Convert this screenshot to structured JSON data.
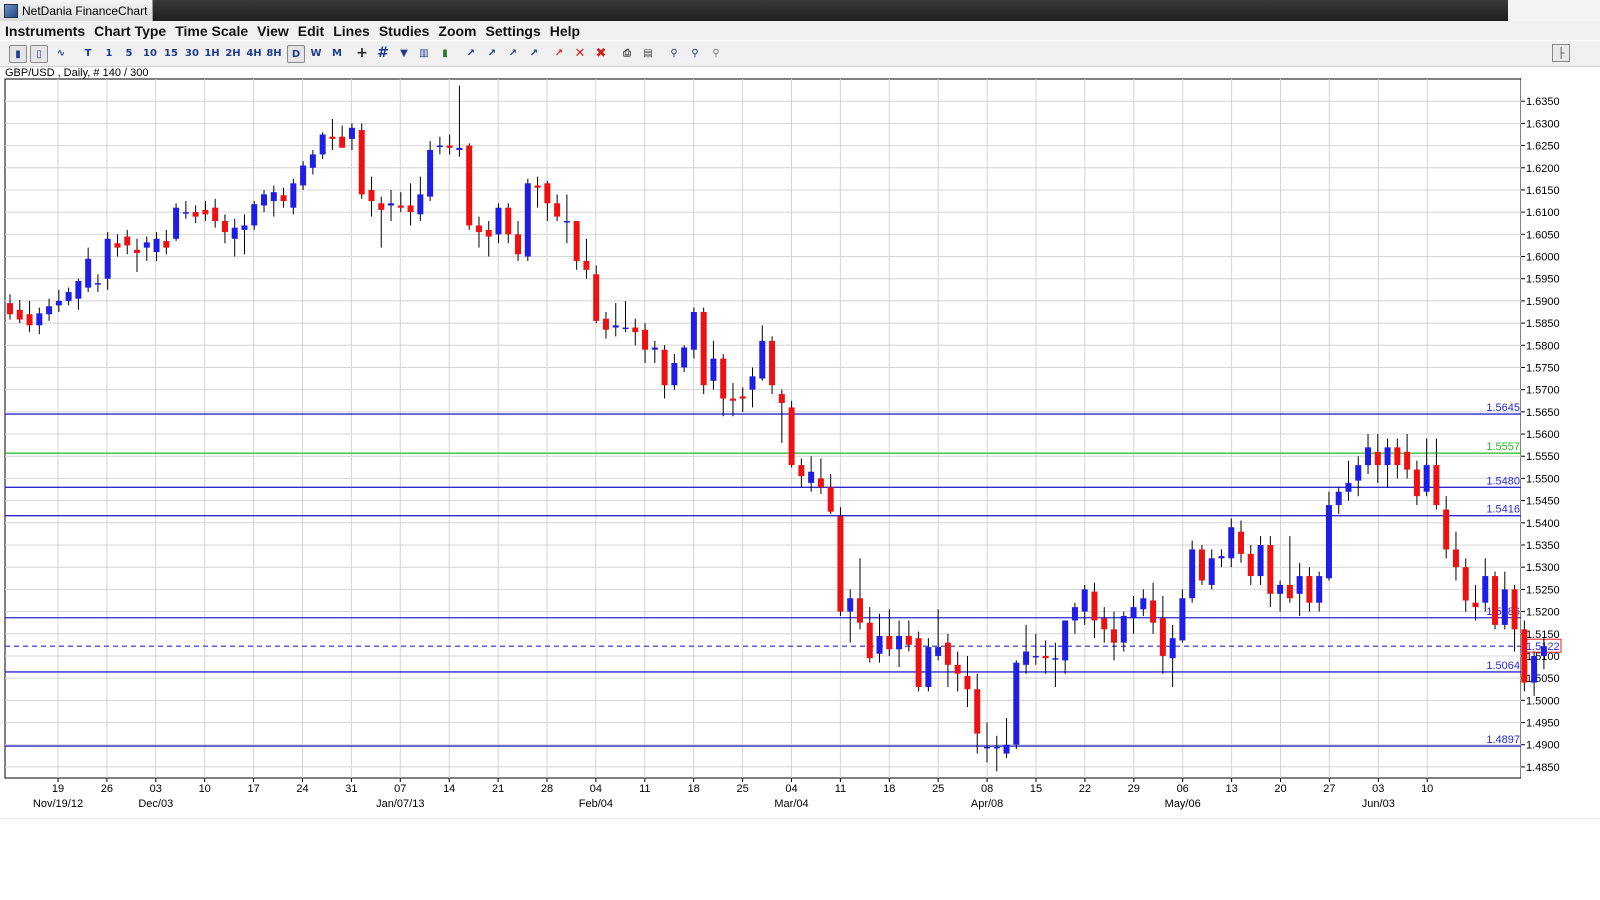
{
  "window": {
    "title": "NetDania FinanceChart"
  },
  "menu": [
    "Instruments",
    "Chart Type",
    "Time Scale",
    "View",
    "Edit",
    "Lines",
    "Studies",
    "Zoom",
    "Settings",
    "Help"
  ],
  "toolbar": {
    "timeframes": [
      "T",
      "1",
      "5",
      "10",
      "15",
      "30",
      "1H",
      "2H",
      "4H",
      "8H",
      "D",
      "W",
      "M"
    ],
    "selected_timeframe": "D",
    "icons": [
      "bar-chart-icon",
      "candlestick-icon",
      "line-chart-icon",
      "crosshair-icon",
      "grid-icon",
      "magnet-icon",
      "volume-icon",
      "fibonacci-icon",
      "studies-icon",
      "delete-line-icon",
      "delete-all-icon",
      "print-icon",
      "print-preview-icon",
      "zoom-in-icon",
      "zoom-out-icon",
      "zoom-reset-icon",
      "pin-icon"
    ]
  },
  "chart_header": "GBP/USD , Daily, # 140 / 300",
  "colors": {
    "up": "#1e1ee6",
    "down": "#ee1111",
    "level": "#2a2ad0",
    "level_green": "#22bb22",
    "grid": "#d4d4d4"
  },
  "chart_data": {
    "type": "candlestick",
    "symbol": "GBP/USD",
    "ylim": [
      1.4825,
      1.64
    ],
    "y_ticks": [
      "1.6350",
      "1.6300",
      "1.6250",
      "1.6200",
      "1.6150",
      "1.6100",
      "1.6050",
      "1.6000",
      "1.5950",
      "1.5900",
      "1.5850",
      "1.5800",
      "1.5750",
      "1.5700",
      "1.5650",
      "1.5600",
      "1.5550",
      "1.5500",
      "1.5450",
      "1.5400",
      "1.5350",
      "1.5300",
      "1.5250",
      "1.5200",
      "1.5150",
      "1.5100",
      "1.5050",
      "1.5000",
      "1.4950",
      "1.4900",
      "1.4850"
    ],
    "x_ticks": [
      "19",
      "26",
      "03",
      "10",
      "17",
      "24",
      "31",
      "07",
      "14",
      "21",
      "28",
      "04",
      "11",
      "18",
      "25",
      "04",
      "11",
      "18",
      "25",
      "08",
      "15",
      "22",
      "29",
      "06",
      "13",
      "20",
      "27",
      "03",
      "10"
    ],
    "x_month_labels": [
      {
        "label": "Nov/19/12",
        "tick_index": 0
      },
      {
        "label": "Dec/03",
        "tick_index": 2
      },
      {
        "label": "Jan/07/13",
        "tick_index": 7
      },
      {
        "label": "Feb/04",
        "tick_index": 11
      },
      {
        "label": "Mar/04",
        "tick_index": 15
      },
      {
        "label": "Apr/08",
        "tick_index": 19
      },
      {
        "label": "May/06",
        "tick_index": 23
      },
      {
        "label": "Jun/03",
        "tick_index": 27
      }
    ],
    "levels": [
      {
        "value": "1.5645",
        "color": "blue"
      },
      {
        "value": "1.5557",
        "color": "green"
      },
      {
        "value": "1.5480",
        "color": "blue"
      },
      {
        "value": "1.5416",
        "color": "blue"
      },
      {
        "value": "1.5186",
        "color": "blue"
      },
      {
        "value": "1.5064",
        "color": "blue"
      },
      {
        "value": "1.4897",
        "color": "blue"
      }
    ],
    "current_price": "1.5122",
    "candles": [
      [
        1.5895,
        1.5915,
        1.5858,
        1.587
      ],
      [
        1.588,
        1.5902,
        1.585,
        1.5858
      ],
      [
        1.587,
        1.59,
        1.583,
        1.5845
      ],
      [
        1.5845,
        1.5885,
        1.5825,
        1.5872
      ],
      [
        1.587,
        1.5905,
        1.5855,
        1.5888
      ],
      [
        1.589,
        1.5925,
        1.5875,
        1.59
      ],
      [
        1.59,
        1.593,
        1.589,
        1.592
      ],
      [
        1.5905,
        1.595,
        1.588,
        1.5945
      ],
      [
        1.593,
        1.602,
        1.592,
        1.5995
      ],
      [
        1.5938,
        1.596,
        1.592,
        1.594
      ],
      [
        1.595,
        1.6055,
        1.5925,
        1.604
      ],
      [
        1.603,
        1.605,
        1.6,
        1.602
      ],
      [
        1.6045,
        1.606,
        1.6005,
        1.6025
      ],
      [
        1.6015,
        1.604,
        1.5965,
        1.6008
      ],
      [
        1.602,
        1.6045,
        1.599,
        1.6032
      ],
      [
        1.601,
        1.6055,
        1.599,
        1.604
      ],
      [
        1.6035,
        1.606,
        1.6005,
        1.602
      ],
      [
        1.604,
        1.612,
        1.6035,
        1.611
      ],
      [
        1.61,
        1.6125,
        1.6085,
        1.61
      ],
      [
        1.61,
        1.6115,
        1.6075,
        1.609
      ],
      [
        1.6105,
        1.6125,
        1.608,
        1.6095
      ],
      [
        1.611,
        1.613,
        1.6065,
        1.608
      ],
      [
        1.608,
        1.6095,
        1.603,
        1.6055
      ],
      [
        1.604,
        1.6085,
        1.6,
        1.6065
      ],
      [
        1.606,
        1.6095,
        1.6005,
        1.607
      ],
      [
        1.607,
        1.6125,
        1.606,
        1.6118
      ],
      [
        1.6115,
        1.615,
        1.61,
        1.614
      ],
      [
        1.6125,
        1.616,
        1.609,
        1.6145
      ],
      [
        1.6138,
        1.6155,
        1.611,
        1.6125
      ],
      [
        1.611,
        1.6175,
        1.6095,
        1.6165
      ],
      [
        1.616,
        1.6215,
        1.615,
        1.6205
      ],
      [
        1.62,
        1.624,
        1.6185,
        1.623
      ],
      [
        1.623,
        1.628,
        1.622,
        1.6275
      ],
      [
        1.627,
        1.631,
        1.624,
        1.6265
      ],
      [
        1.627,
        1.6295,
        1.625,
        1.6245
      ],
      [
        1.6265,
        1.63,
        1.624,
        1.629
      ],
      [
        1.6285,
        1.63,
        1.613,
        1.614
      ],
      [
        1.615,
        1.618,
        1.609,
        1.6125
      ],
      [
        1.612,
        1.6135,
        1.602,
        1.6105
      ],
      [
        1.6115,
        1.615,
        1.608,
        1.612
      ],
      [
        1.6115,
        1.6145,
        1.61,
        1.611
      ],
      [
        1.6115,
        1.6165,
        1.607,
        1.61
      ],
      [
        1.6095,
        1.618,
        1.608,
        1.614
      ],
      [
        1.6135,
        1.626,
        1.6125,
        1.624
      ],
      [
        1.625,
        1.627,
        1.623,
        1.625
      ],
      [
        1.625,
        1.6275,
        1.623,
        1.6245
      ],
      [
        1.624,
        1.6385,
        1.6225,
        1.6245
      ],
      [
        1.625,
        1.6255,
        1.606,
        1.607
      ],
      [
        1.607,
        1.609,
        1.602,
        1.6055
      ],
      [
        1.606,
        1.608,
        1.6,
        1.6045
      ],
      [
        1.605,
        1.612,
        1.603,
        1.611
      ],
      [
        1.611,
        1.612,
        1.603,
        1.605
      ],
      [
        1.605,
        1.608,
        1.599,
        1.6005
      ],
      [
        1.6,
        1.6175,
        1.599,
        1.6165
      ],
      [
        1.616,
        1.618,
        1.611,
        1.6155
      ],
      [
        1.6165,
        1.617,
        1.608,
        1.612
      ],
      [
        1.612,
        1.614,
        1.608,
        1.609
      ],
      [
        1.608,
        1.614,
        1.603,
        1.608
      ],
      [
        1.608,
        1.608,
        1.597,
        1.599
      ],
      [
        1.599,
        1.604,
        1.595,
        1.597
      ],
      [
        1.596,
        1.598,
        1.585,
        1.5855
      ],
      [
        1.586,
        1.5875,
        1.5815,
        1.5835
      ],
      [
        1.584,
        1.5895,
        1.582,
        1.5845
      ],
      [
        1.584,
        1.59,
        1.583,
        1.584
      ],
      [
        1.584,
        1.586,
        1.58,
        1.583
      ],
      [
        1.5835,
        1.585,
        1.576,
        1.579
      ],
      [
        1.579,
        1.581,
        1.576,
        1.5795
      ],
      [
        1.579,
        1.58,
        1.568,
        1.571
      ],
      [
        1.571,
        1.578,
        1.57,
        1.576
      ],
      [
        1.575,
        1.58,
        1.574,
        1.5795
      ],
      [
        1.579,
        1.5885,
        1.577,
        1.5875
      ],
      [
        1.5875,
        1.5885,
        1.569,
        1.571
      ],
      [
        1.572,
        1.581,
        1.57,
        1.577
      ],
      [
        1.577,
        1.578,
        1.564,
        1.568
      ],
      [
        1.568,
        1.5715,
        1.564,
        1.5675
      ],
      [
        1.5685,
        1.5705,
        1.565,
        1.568
      ],
      [
        1.57,
        1.575,
        1.566,
        1.573
      ],
      [
        1.5725,
        1.5845,
        1.572,
        1.581
      ],
      [
        1.581,
        1.582,
        1.569,
        1.571
      ],
      [
        1.569,
        1.57,
        1.558,
        1.567
      ],
      [
        1.566,
        1.5675,
        1.5525,
        1.553
      ],
      [
        1.553,
        1.5545,
        1.548,
        1.5505
      ],
      [
        1.549,
        1.555,
        1.547,
        1.5515
      ],
      [
        1.55,
        1.5545,
        1.5465,
        1.548
      ],
      [
        1.548,
        1.551,
        1.542,
        1.5425
      ],
      [
        1.5415,
        1.5435,
        1.519,
        1.52
      ],
      [
        1.52,
        1.525,
        1.513,
        1.523
      ],
      [
        1.523,
        1.532,
        1.516,
        1.5175
      ],
      [
        1.5175,
        1.521,
        1.5085,
        1.5095
      ],
      [
        1.5105,
        1.5195,
        1.5085,
        1.5145
      ],
      [
        1.5145,
        1.5205,
        1.51,
        1.5115
      ],
      [
        1.5115,
        1.518,
        1.5075,
        1.5145
      ],
      [
        1.5145,
        1.518,
        1.511,
        1.5125
      ],
      [
        1.514,
        1.5155,
        1.502,
        1.503
      ],
      [
        1.503,
        1.514,
        1.502,
        1.512
      ],
      [
        1.51,
        1.5205,
        1.509,
        1.512
      ],
      [
        1.513,
        1.515,
        1.503,
        1.508
      ],
      [
        1.508,
        1.511,
        1.502,
        1.506
      ],
      [
        1.5055,
        1.51,
        1.4985,
        1.5025
      ],
      [
        1.5025,
        1.506,
        1.488,
        1.4925
      ],
      [
        1.4895,
        1.495,
        1.486,
        1.4895
      ],
      [
        1.4895,
        1.492,
        1.484,
        1.4895
      ],
      [
        1.488,
        1.496,
        1.487,
        1.49
      ],
      [
        1.49,
        1.509,
        1.489,
        1.5085
      ],
      [
        1.508,
        1.517,
        1.506,
        1.511
      ],
      [
        1.51,
        1.515,
        1.508,
        1.51
      ],
      [
        1.51,
        1.5135,
        1.506,
        1.5095
      ],
      [
        1.5095,
        1.513,
        1.503,
        1.5095
      ],
      [
        1.509,
        1.517,
        1.506,
        1.518
      ],
      [
        1.518,
        1.522,
        1.515,
        1.521
      ],
      [
        1.52,
        1.526,
        1.517,
        1.525
      ],
      [
        1.5245,
        1.5265,
        1.514,
        1.518
      ],
      [
        1.5185,
        1.521,
        1.513,
        1.516
      ],
      [
        1.516,
        1.52,
        1.509,
        1.513
      ],
      [
        1.513,
        1.52,
        1.511,
        1.519
      ],
      [
        1.5185,
        1.5235,
        1.515,
        1.521
      ],
      [
        1.5205,
        1.525,
        1.519,
        1.523
      ],
      [
        1.5225,
        1.5265,
        1.515,
        1.5175
      ],
      [
        1.5185,
        1.5235,
        1.506,
        1.51
      ],
      [
        1.5095,
        1.517,
        1.503,
        1.514
      ],
      [
        1.5135,
        1.525,
        1.513,
        1.523
      ],
      [
        1.523,
        1.536,
        1.522,
        1.534
      ],
      [
        1.534,
        1.535,
        1.526,
        1.527
      ],
      [
        1.526,
        1.534,
        1.525,
        1.532
      ],
      [
        1.532,
        1.534,
        1.53,
        1.5325
      ],
      [
        1.532,
        1.541,
        1.53,
        1.539
      ],
      [
        1.538,
        1.5405,
        1.531,
        1.533
      ],
      [
        1.533,
        1.535,
        1.526,
        1.528
      ],
      [
        1.528,
        1.537,
        1.526,
        1.535
      ],
      [
        1.535,
        1.537,
        1.521,
        1.524
      ],
      [
        1.524,
        1.527,
        1.52,
        1.526
      ],
      [
        1.526,
        1.537,
        1.522,
        1.523
      ],
      [
        1.524,
        1.531,
        1.519,
        1.528
      ],
      [
        1.528,
        1.53,
        1.52,
        1.522
      ],
      [
        1.522,
        1.529,
        1.52,
        1.528
      ],
      [
        1.5275,
        1.547,
        1.527,
        1.544
      ],
      [
        1.544,
        1.548,
        1.542,
        1.547
      ],
      [
        1.547,
        1.554,
        1.545,
        1.549
      ],
      [
        1.5495,
        1.555,
        1.546,
        1.553
      ],
      [
        1.553,
        1.56,
        1.551,
        1.557
      ],
      [
        1.556,
        1.56,
        1.549,
        1.553
      ],
      [
        1.553,
        1.559,
        1.548,
        1.557
      ],
      [
        1.557,
        1.559,
        1.55,
        1.553
      ],
      [
        1.556,
        1.56,
        1.55,
        1.552
      ],
      [
        1.552,
        1.554,
        1.544,
        1.546
      ],
      [
        1.547,
        1.559,
        1.546,
        1.553
      ],
      [
        1.553,
        1.559,
        1.543,
        1.544
      ],
      [
        1.543,
        1.546,
        1.532,
        1.534
      ],
      [
        1.534,
        1.538,
        1.527,
        1.53
      ],
      [
        1.53,
        1.532,
        1.52,
        1.5225
      ],
      [
        1.522,
        1.526,
        1.518,
        1.521
      ],
      [
        1.522,
        1.532,
        1.52,
        1.528
      ],
      [
        1.528,
        1.529,
        1.516,
        1.517
      ],
      [
        1.517,
        1.529,
        1.516,
        1.525
      ],
      [
        1.525,
        1.526,
        1.511,
        1.516
      ],
      [
        1.516,
        1.518,
        1.502,
        1.504
      ],
      [
        1.504,
        1.511,
        1.501,
        1.51
      ],
      [
        1.51,
        1.514,
        1.507,
        1.5122
      ]
    ]
  }
}
